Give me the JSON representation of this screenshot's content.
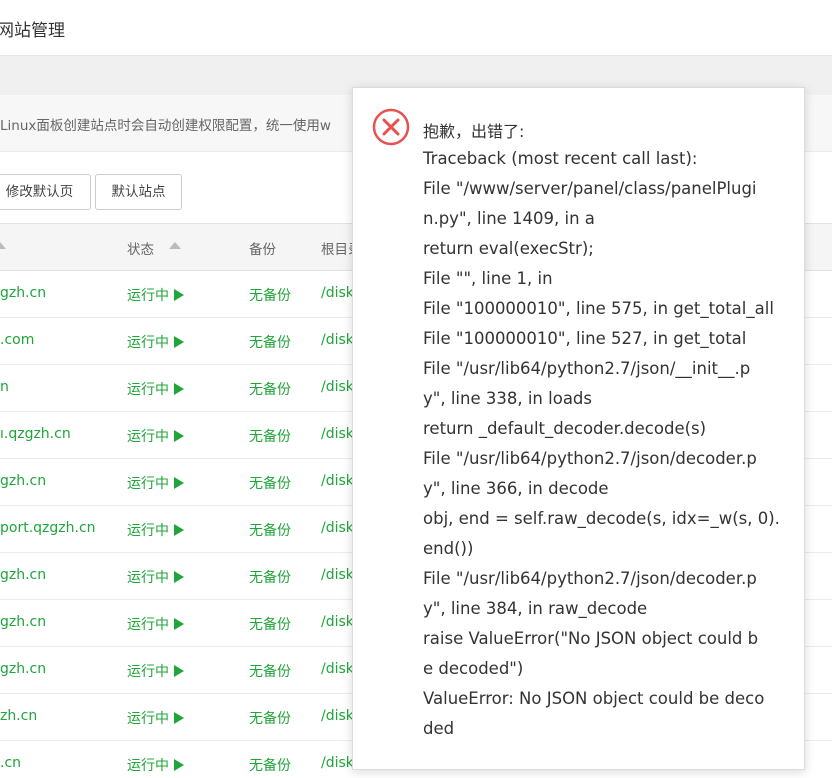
{
  "header": {
    "title": "网站管理"
  },
  "notice": {
    "text": "Linux面板创建站点时会自动创建权限配置，统一使用w"
  },
  "toolbar": {
    "edit_default_page": "修改默认页",
    "default_site": "默认站点"
  },
  "table": {
    "columns": {
      "site": "",
      "status": "状态",
      "backup": "备份",
      "root": "根目录"
    },
    "rows": [
      {
        "site": "gzh.cn",
        "status": "运行中",
        "backup": "无备份",
        "root": "/disk"
      },
      {
        "site": ".com",
        "status": "运行中",
        "backup": "无备份",
        "root": "/disk"
      },
      {
        "site": "n",
        "status": "运行中",
        "backup": "无备份",
        "root": "/disk"
      },
      {
        "site": "ı.qzgzh.cn",
        "status": "运行中",
        "backup": "无备份",
        "root": "/disk"
      },
      {
        "site": "gzh.cn",
        "status": "运行中",
        "backup": "无备份",
        "root": "/disk"
      },
      {
        "site": "port.qzgzh.cn",
        "status": "运行中",
        "backup": "无备份",
        "root": "/disk"
      },
      {
        "site": "gzh.cn",
        "status": "运行中",
        "backup": "无备份",
        "root": "/disk"
      },
      {
        "site": "gzh.cn",
        "status": "运行中",
        "backup": "无备份",
        "root": "/disk"
      },
      {
        "site": "gzh.cn",
        "status": "运行中",
        "backup": "无备份",
        "root": "/disk"
      },
      {
        "site": "zh.cn",
        "status": "运行中",
        "backup": "无备份",
        "root": "/disk"
      },
      {
        "site": ".cn",
        "status": "运行中",
        "backup": "无备份",
        "root": "/disk"
      }
    ]
  },
  "error_dialog": {
    "title": "抱歉，出错了:",
    "lines": [
      "Traceback (most recent call last):",
      "File \"/www/server/panel/class/panelPlugi",
      "n.py\", line 1409, in a",
      "return eval(execStr);",
      "File \"\", line 1, in",
      "File \"100000010\", line 575, in get_total_all",
      "File \"100000010\", line 527, in get_total",
      "File \"/usr/lib64/python2.7/json/__init__.p",
      "y\", line 338, in loads",
      "return _default_decoder.decode(s)",
      "File \"/usr/lib64/python2.7/json/decoder.p",
      "y\", line 366, in decode",
      "obj, end = self.raw_decode(s, idx=_w(s, 0).",
      "end())",
      "File \"/usr/lib64/python2.7/json/decoder.p",
      "y\", line 384, in raw_decode",
      "raise ValueError(\"No JSON object could b",
      "e decoded\")",
      "ValueError: No JSON object could be deco",
      "ded"
    ]
  },
  "colors": {
    "accent_green": "#20a53a",
    "error_red": "#e8514f"
  }
}
